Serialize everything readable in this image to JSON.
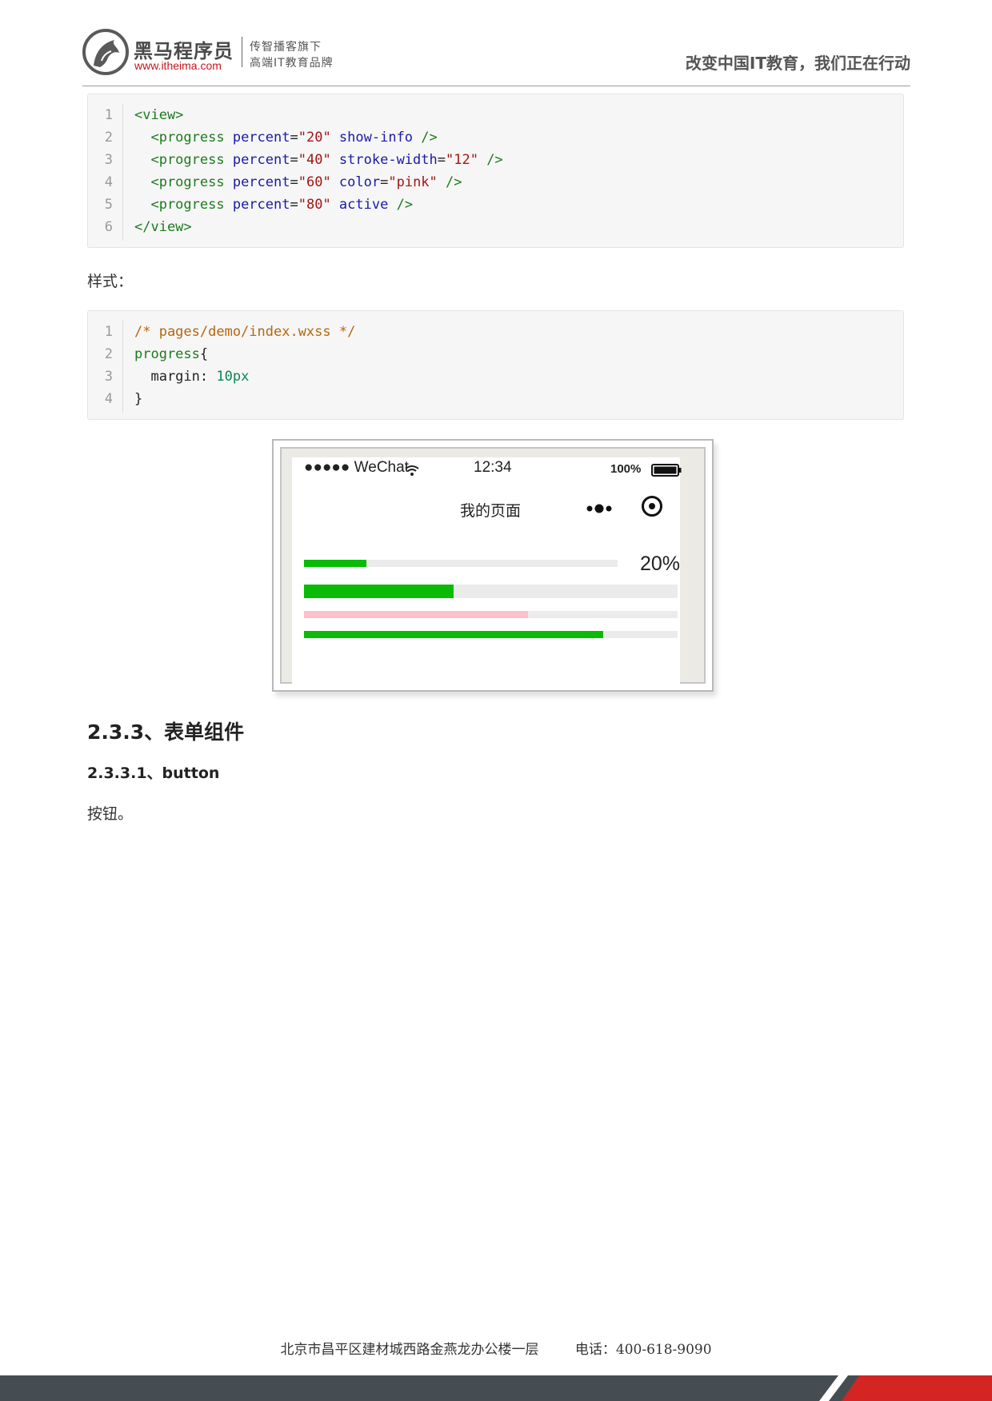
{
  "header": {
    "logo_name": "黑马程序员",
    "logo_url": "www.itheima.com",
    "slogan_line1": "传智播客旗下",
    "slogan_line2": "高端IT教育品牌",
    "motto": "改变中国IT教育，我们正在行动"
  },
  "code_block_1": {
    "line_numbers": [
      "1",
      "2",
      "3",
      "4",
      "5",
      "6"
    ],
    "lines": [
      [
        "<view>"
      ],
      [
        "  <progress ",
        "percent",
        "=",
        "\"20\"",
        " show-info",
        " />"
      ],
      [
        "  <progress ",
        "percent",
        "=",
        "\"40\"",
        " stroke-width",
        "=",
        "\"12\"",
        " />"
      ],
      [
        "  <progress ",
        "percent",
        "=",
        "\"60\"",
        " color",
        "=",
        "\"pink\"",
        " />"
      ],
      [
        "  <progress ",
        "percent",
        "=",
        "\"80\"",
        " active",
        " />"
      ],
      [
        "</view>"
      ]
    ]
  },
  "style_label": "样式：",
  "code_block_2": {
    "line_numbers": [
      "1",
      "2",
      "3",
      "4"
    ],
    "lines": [
      [
        "/* pages/demo/index.wxss */"
      ],
      [
        "progress",
        "{"
      ],
      [
        "  margin: ",
        "10px"
      ],
      [
        "}"
      ]
    ]
  },
  "phone": {
    "carrier": "●●●●● WeChat",
    "time": "12:34",
    "battery": "100%",
    "page_title": "我的页面",
    "info_text": "20%",
    "progress_bars": [
      {
        "percent": 20,
        "color": "#09bb07",
        "show_info": true
      },
      {
        "percent": 40,
        "color": "#09bb07",
        "stroke": "thick"
      },
      {
        "percent": 60,
        "color": "#ffc0cb"
      },
      {
        "percent": 80,
        "color": "#09bb07"
      }
    ]
  },
  "section_heading": "2.3.3、表单组件",
  "subsection_heading": "2.3.3.1、button",
  "body_text": "按钮。",
  "footer": {
    "address": "北京市昌平区建材城西路金燕龙办公楼一层",
    "phone": "电话：400-618-9090"
  },
  "colors": {
    "brand_red": "#c7161d",
    "progress_green": "#09bb07",
    "progress_pink": "#ffc0cb",
    "footer_dark": "#454d52"
  }
}
